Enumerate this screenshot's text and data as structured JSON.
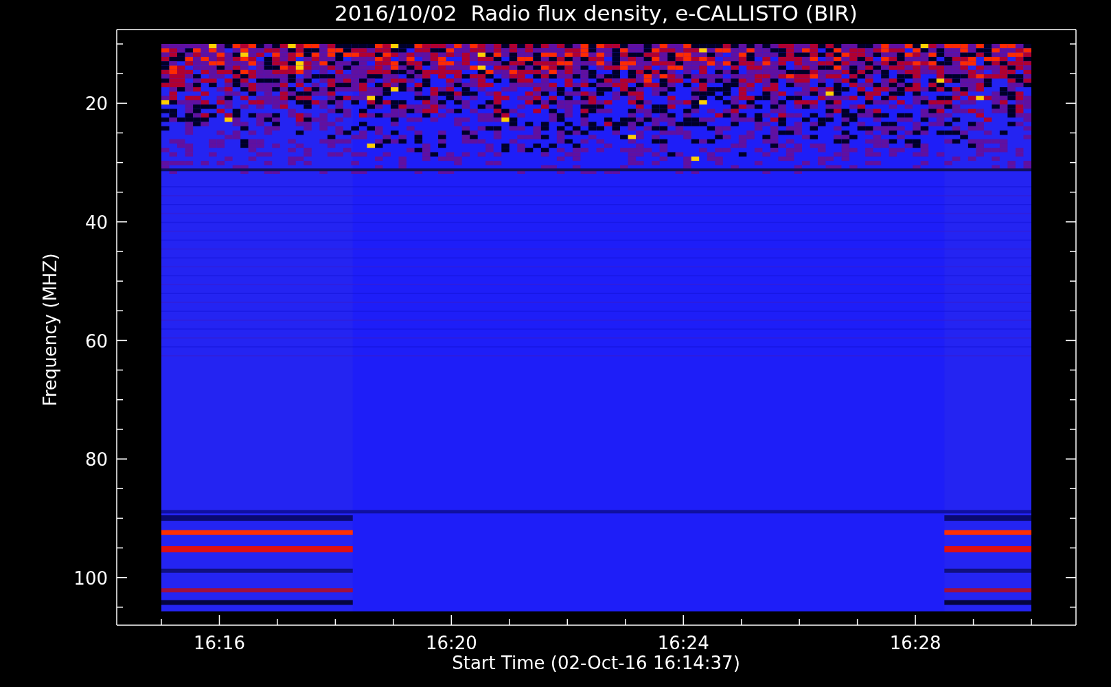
{
  "title": "2016/10/02  Radio flux density, e-CALLISTO (BIR)",
  "y_axis": {
    "label": "Frequency (MHZ)",
    "ticks": [
      "20",
      "40",
      "60",
      "80",
      "100"
    ]
  },
  "x_axis": {
    "label": "Start Time (02-Oct-16 16:14:37)",
    "ticks": [
      "16:16",
      "16:20",
      "16:24",
      "16:28"
    ]
  }
}
